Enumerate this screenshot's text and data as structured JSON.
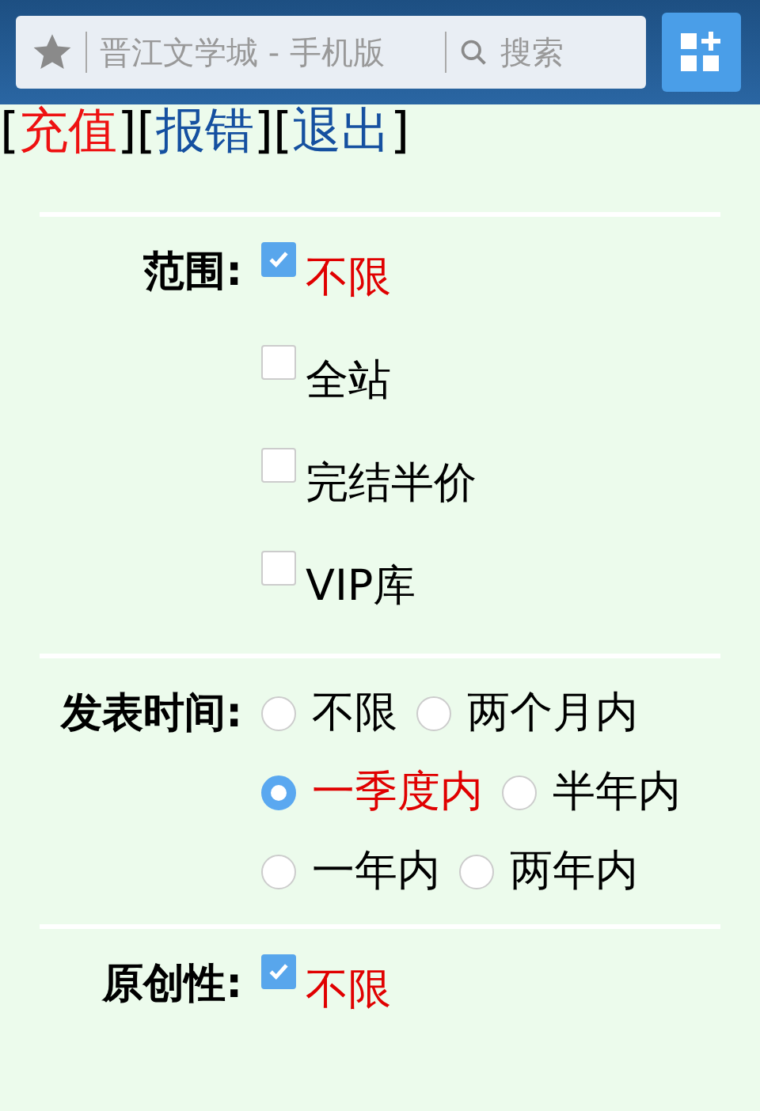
{
  "browser_bar": {
    "title": "晋江文学城 - 手机版",
    "search_placeholder": "搜索"
  },
  "links": [
    {
      "open": "[",
      "label": "充值",
      "close": "]",
      "color": "#ee1111"
    },
    {
      "open": "[",
      "label": "报错",
      "close": "]",
      "color": "#1550a0"
    },
    {
      "open": "[",
      "label": "退出",
      "close": "]",
      "color": "#1550a0"
    }
  ],
  "filters": [
    {
      "label": "范围:",
      "kind": "checkbox",
      "options": [
        {
          "label": "不限",
          "selected": true
        },
        {
          "label": "全站",
          "selected": false
        },
        {
          "label": "完结半价",
          "selected": false
        },
        {
          "label": "VIP库",
          "selected": false
        }
      ]
    },
    {
      "label": "发表时间:",
      "kind": "radio",
      "options": [
        {
          "label": "不限",
          "selected": false
        },
        {
          "label": "两个月内",
          "selected": false
        },
        {
          "label": "一季度内",
          "selected": true
        },
        {
          "label": "半年内",
          "selected": false
        },
        {
          "label": "一年内",
          "selected": false
        },
        {
          "label": "两年内",
          "selected": false
        }
      ]
    },
    {
      "label": "原创性:",
      "kind": "checkbox",
      "options": [
        {
          "label": "不限",
          "selected": true
        }
      ]
    }
  ]
}
